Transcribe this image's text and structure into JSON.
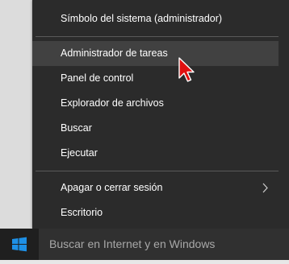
{
  "context_menu": {
    "items": [
      {
        "label": "Símbolo del sistema (administrador)"
      },
      {
        "label": "Administrador de tareas"
      },
      {
        "label": "Panel de control"
      },
      {
        "label": "Explorador de archivos"
      },
      {
        "label": "Buscar"
      },
      {
        "label": "Ejecutar"
      },
      {
        "label": "Apagar o cerrar sesión"
      },
      {
        "label": "Escritorio"
      }
    ],
    "hovered_item": "Administrador de tareas"
  },
  "taskbar": {
    "search_placeholder": "Buscar en Internet y en Windows",
    "start_icon": "windows-logo-icon"
  },
  "colors": {
    "menu_bg": "#2b2b2b",
    "menu_hover": "#414141",
    "taskbar_bg": "#1f1f1f",
    "windows_blue": "#1e90e6",
    "cursor_red": "#e01010"
  }
}
